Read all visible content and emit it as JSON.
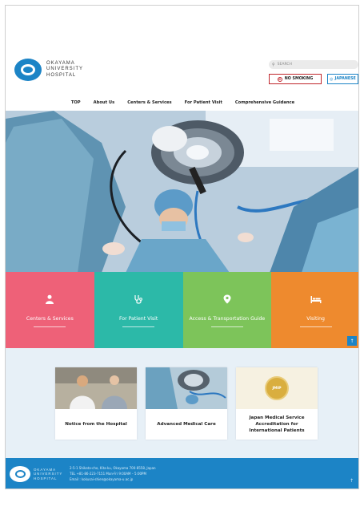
{
  "header": {
    "logo_lines": [
      "OKAYAMA",
      "UNIVERSITY",
      "HOSPITAL"
    ],
    "search_placeholder": "SEARCH",
    "no_smoking_label": "NO SMOKING",
    "language_label": "JAPANESE"
  },
  "nav": {
    "items": [
      "TOP",
      "About Us",
      "Centers & Services",
      "For Patient Visit",
      "Comprehensive Guidance"
    ]
  },
  "tiles": [
    {
      "label": "Centers & Services",
      "icon": "doctor-icon",
      "color": "#ee6178"
    },
    {
      "label": "For Patient Visit",
      "icon": "stethoscope-icon",
      "color": "#2cb9a8"
    },
    {
      "label": "Access & Transportation Guide",
      "icon": "map-pin-icon",
      "color": "#7dc45a"
    },
    {
      "label": "Visiting",
      "icon": "bed-icon",
      "color": "#ee8a2e"
    }
  ],
  "cards": [
    {
      "caption": "Notice from the Hospital"
    },
    {
      "caption": "Advanced Medical Care"
    },
    {
      "caption": "Japan Medical Service Accreditation for International Patients",
      "badge": "JMIP"
    }
  ],
  "footer": {
    "logo_lines": [
      "OKAYAMA",
      "UNIVERSITY",
      "HOSPITAL"
    ],
    "address": "2-5-1 Shikata-cho, Kita-ku, Okayama 700-8558, Japan",
    "tel": "TEL +81-86-223-7151    Mon-Fri 9:00AM – 5:00PM",
    "email": "Email : kokusai-shien@okayama-u.ac.jp"
  },
  "colors": {
    "brand": "#1c84c6",
    "no_smoking_red": "#c0272d"
  }
}
